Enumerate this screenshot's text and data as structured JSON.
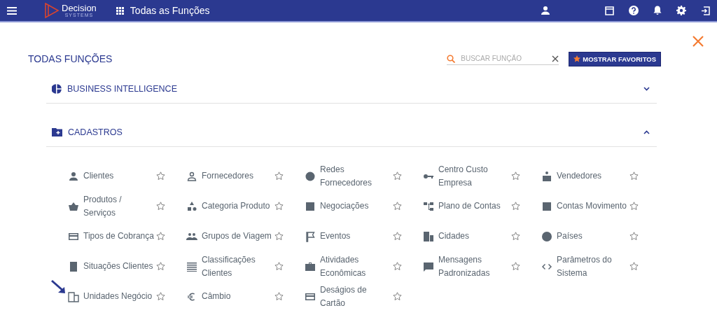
{
  "topbar": {
    "logo_name": "Decision",
    "logo_sub": "SYSTEMS",
    "page_title": "Todas as Funções"
  },
  "heading": "TODAS FUNÇÕES",
  "search": {
    "placeholder": "BUSCAR FUNÇÃO"
  },
  "favorites_button": "MOSTRAR FAVORITOS",
  "sections": [
    {
      "title": "BUSINESS INTELLIGENCE",
      "expanded": false
    },
    {
      "title": "CADASTROS",
      "expanded": true,
      "items": [
        {
          "label": "Clientes",
          "favorite": false
        },
        {
          "label": "Fornecedores",
          "favorite": false
        },
        {
          "label": "Redes Fornecedores",
          "favorite": false
        },
        {
          "label": "Centro Custo Empresa",
          "favorite": false
        },
        {
          "label": "Vendedores",
          "favorite": false
        },
        {
          "label": "Produtos / Serviços",
          "favorite": false
        },
        {
          "label": "Categoria Produto",
          "favorite": false
        },
        {
          "label": "Negociações",
          "favorite": false
        },
        {
          "label": "Plano de Contas",
          "favorite": false
        },
        {
          "label": "Contas Movimento",
          "favorite": false
        },
        {
          "label": "Tipos de Cobrança",
          "favorite": false
        },
        {
          "label": "Grupos de Viagem",
          "favorite": false
        },
        {
          "label": "Eventos",
          "favorite": false
        },
        {
          "label": "Cidades",
          "favorite": false
        },
        {
          "label": "Países",
          "favorite": false
        },
        {
          "label": "Situações Clientes",
          "favorite": false
        },
        {
          "label": "Classificações Clientes",
          "favorite": false
        },
        {
          "label": "Atividades Econômicas",
          "favorite": false
        },
        {
          "label": "Mensagens Padronizadas",
          "favorite": false
        },
        {
          "label": "Parâmetros do Sistema",
          "favorite": false
        },
        {
          "label": "Unidades Negócio",
          "favorite": false
        },
        {
          "label": "Câmbio",
          "favorite": false
        },
        {
          "label": "Deságios de Cartão",
          "favorite": false
        }
      ]
    }
  ]
}
